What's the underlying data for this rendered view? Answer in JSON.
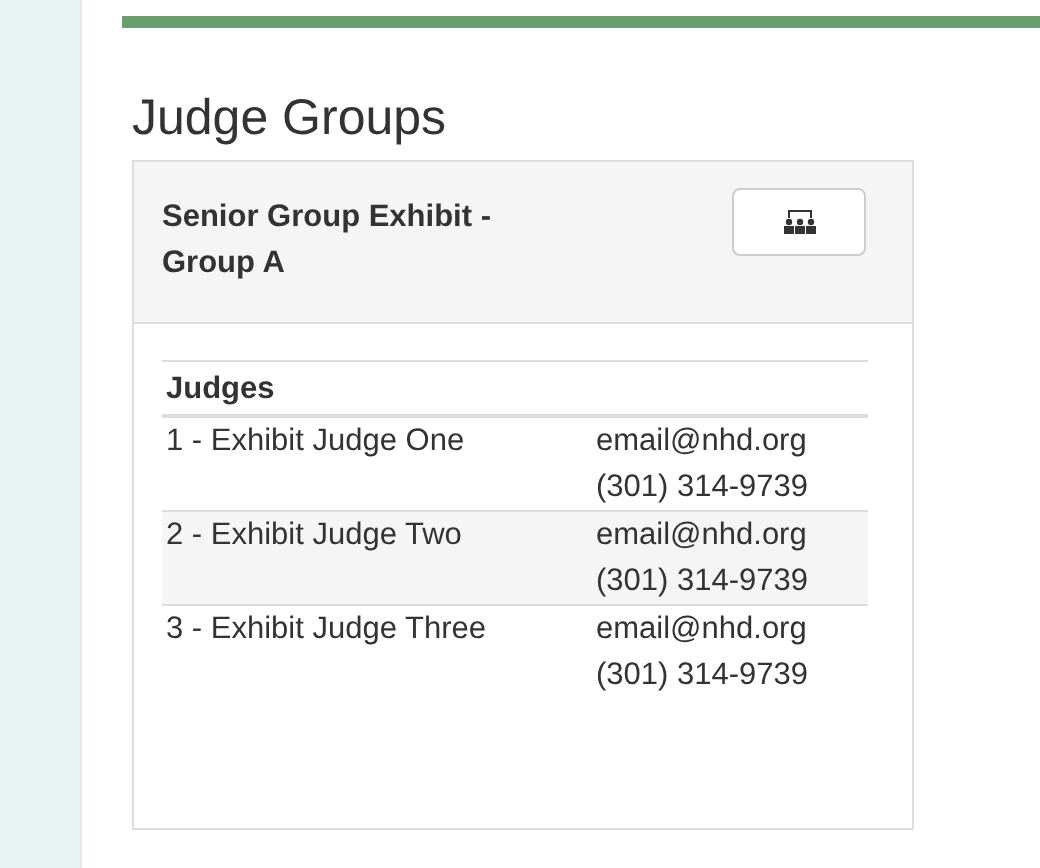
{
  "page_title": "Judge Groups",
  "panel": {
    "title": "Senior Group Exhibit - Group A"
  },
  "table": {
    "columns": [
      "Judges"
    ],
    "rows": [
      {
        "name": "1 - Exhibit Judge One",
        "email": "email@nhd.org",
        "phone": "(301) 314-9739"
      },
      {
        "name": "2 - Exhibit Judge Two",
        "email": "email@nhd.org",
        "phone": "(301) 314-9739"
      },
      {
        "name": "3 - Exhibit Judge Three",
        "email": "email@nhd.org",
        "phone": "(301) 314-9739"
      }
    ]
  }
}
